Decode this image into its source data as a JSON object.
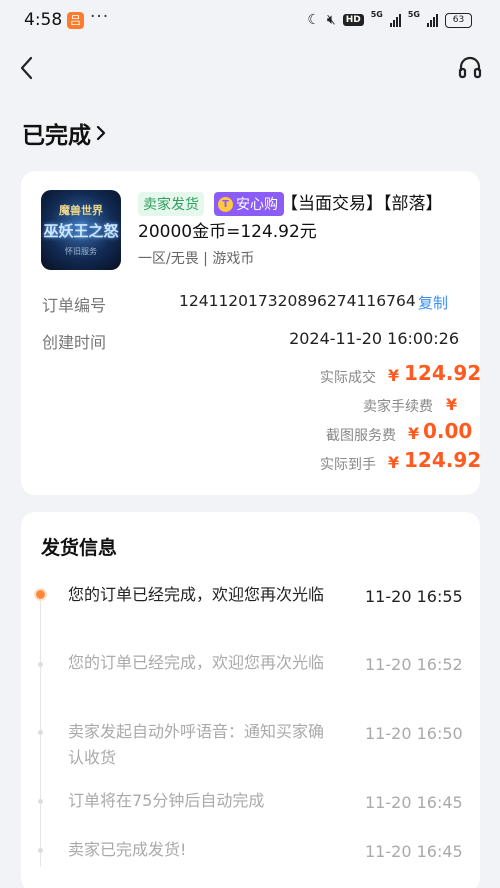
{
  "status_bar": {
    "time": "4:58",
    "app_icon_glyph": "吕",
    "dots": "···",
    "hd": "HD",
    "net1": "5G",
    "net2": "5G",
    "battery": "63"
  },
  "page": {
    "title": "已完成"
  },
  "order": {
    "thumbnail": {
      "line1": "魔兽世界",
      "line2": "巫妖王之怒",
      "line3": "怀旧服务"
    },
    "tag_seller": "卖家发货",
    "tag_safe": "安心购",
    "tag_safe_icon": "T",
    "title": "【当面交易】【部落】20000金币=124.92元",
    "subtitle": "一区/无畏 | 游戏币",
    "order_no_label": "订单编号",
    "order_no": "12411201732089627411​6764",
    "copy_label": "复制",
    "created_label": "创建时间",
    "created_value": "2024-11-20 16:00:26",
    "fees": [
      {
        "label": "实际成交",
        "yen": "¥",
        "amount": "124.92"
      },
      {
        "label": "卖家手续费",
        "yen": "¥",
        "amount": ""
      },
      {
        "label": "截图服务费",
        "yen": "¥",
        "amount": "0.00"
      },
      {
        "label": "实际到手",
        "yen": "¥",
        "amount": "124.92"
      }
    ]
  },
  "shipping": {
    "title": "发货信息",
    "events": [
      {
        "text": "您的订单已经完成，欢迎您再次光临",
        "time": "11-20 16:55",
        "active": true
      },
      {
        "text": "您的订单已经完成，欢迎您再次光临",
        "time": "11-20 16:52",
        "active": false
      },
      {
        "text": "卖家发起自动外呼语音：通知买家确认收货",
        "time": "11-20 16:50",
        "active": false
      },
      {
        "text": "订单将在75分钟后自动完成",
        "time": "11-20 16:45",
        "active": false
      },
      {
        "text": "卖家已完成发货!",
        "time": "11-20 16:45",
        "active": false
      }
    ]
  },
  "colors": {
    "accent": "#ff5a1f",
    "link": "#3a8ff0",
    "safe_tag": "#8b5cf6",
    "seller_tag": "#2ea060"
  }
}
